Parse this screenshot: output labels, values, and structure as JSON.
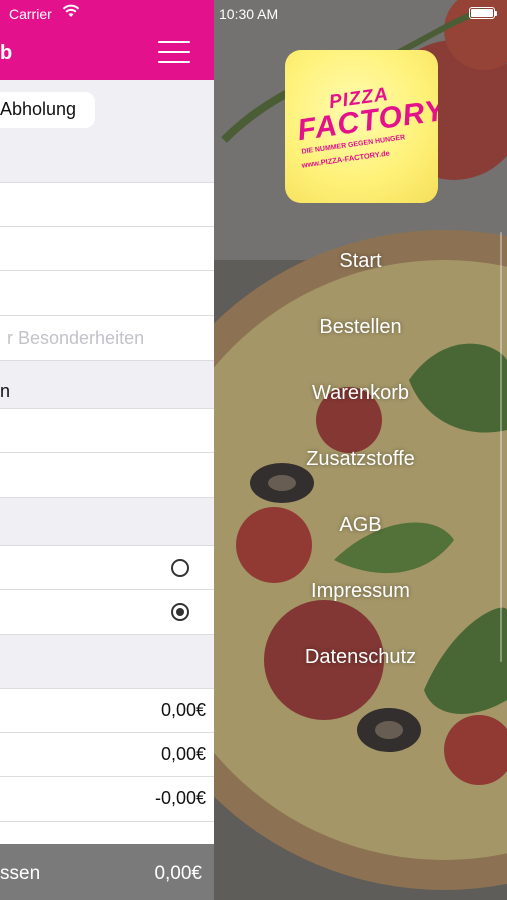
{
  "left": {
    "status": {
      "carrier": "Carrier"
    },
    "navbar": {
      "title": "b"
    },
    "pickup_pill": "Abholung",
    "notes_placeholder": "r Besonderheiten",
    "section_label_1": "n",
    "price_rows": [
      "0,00€",
      "0,00€",
      "-0,00€"
    ],
    "footer": {
      "label": "ssen",
      "total": "0,00€"
    }
  },
  "right": {
    "status": {
      "time": "10:30 AM"
    },
    "logo": {
      "line1": "PIZZA",
      "line2": "FACTORY",
      "tagline": "DIE NUMMER GEGEN HUNGER",
      "url": "www.PIZZA-FACTORY.de"
    },
    "menu": [
      {
        "label": "Start"
      },
      {
        "label": "Bestellen"
      },
      {
        "label": "Warenkorb"
      },
      {
        "label": "Zusatzstoffe"
      },
      {
        "label": "AGB"
      },
      {
        "label": "Impressum"
      },
      {
        "label": "Datenschutz"
      }
    ]
  },
  "colors": {
    "brand": "#e4118c",
    "footer": "#7a7a7a"
  }
}
